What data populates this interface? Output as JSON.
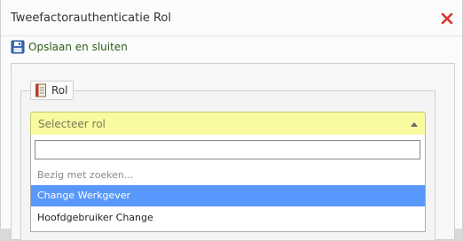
{
  "dialog": {
    "title": "Tweefactorauthenticatie Rol",
    "close_icon": "close-icon"
  },
  "toolbar": {
    "save_label": "Opslaan en sluiten",
    "save_icon": "floppy-disk-icon"
  },
  "fieldset": {
    "legend_label": "Rol",
    "legend_icon": "book-icon"
  },
  "role_select": {
    "placeholder": "Selecteer rol",
    "search_value": "",
    "status": "Bezig met zoeken...",
    "options": [
      {
        "label": "Change Werkgever",
        "highlighted": true
      },
      {
        "label": "Hoofdgebruiker Change",
        "highlighted": false
      }
    ]
  },
  "colors": {
    "close": "#d9342b",
    "save_text": "#2b5f1a",
    "select_bg": "#fafaa0",
    "highlight": "#5897fb"
  }
}
